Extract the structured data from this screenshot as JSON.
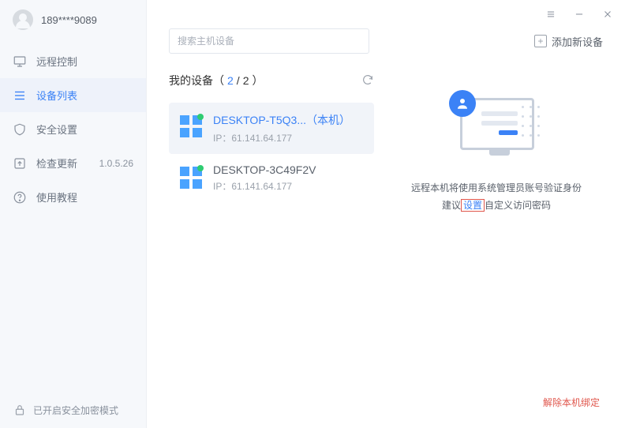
{
  "user": {
    "name": "189****9089"
  },
  "sidebar": {
    "items": [
      {
        "label": "远程控制"
      },
      {
        "label": "设备列表"
      },
      {
        "label": "安全设置"
      },
      {
        "label": "检查更新",
        "version": "1.0.5.26"
      },
      {
        "label": "使用教程"
      }
    ],
    "footer": "已开启安全加密模式"
  },
  "window": {
    "menu": "≡",
    "minimize": "—",
    "close": "✕"
  },
  "search": {
    "placeholder": "搜索主机设备"
  },
  "add_device": "添加新设备",
  "devices": {
    "header_prefix": "我的设备（",
    "count_shown": "2",
    "count_sep": "/",
    "count_total": "2",
    "header_suffix": "）",
    "items": [
      {
        "name": "DESKTOP-T5Q3...（本机）",
        "ip_label": "IP：",
        "ip": "61.141.64.177"
      },
      {
        "name": "DESKTOP-3C49F2V",
        "ip_label": "IP：",
        "ip": "61.141.64.177"
      }
    ]
  },
  "detail": {
    "line1": "远程本机将使用系统管理员账号验证身份",
    "line2_prefix": "建议",
    "line2_link": "设置",
    "line2_suffix": "自定义访问密码",
    "unlink": "解除本机绑定"
  }
}
